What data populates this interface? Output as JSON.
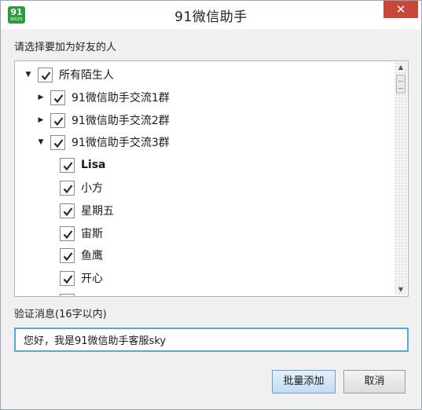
{
  "window": {
    "title": "91微信助手",
    "logo_top": "91",
    "logo_bottom": "WXZS",
    "close_glyph": "✕"
  },
  "prompt": "请选择要加为好友的人",
  "tree": {
    "root": {
      "label": "所有陌生人",
      "expanded": true,
      "checked": true
    },
    "groups": [
      {
        "label": "91微信助手交流1群",
        "expanded": false,
        "checked": true
      },
      {
        "label": "91微信助手交流2群",
        "expanded": false,
        "checked": true
      },
      {
        "label": "91微信助手交流3群",
        "expanded": true,
        "checked": true
      }
    ],
    "members": [
      {
        "label": "Lisa",
        "checked": true
      },
      {
        "label": "小方",
        "checked": true
      },
      {
        "label": "星期五",
        "checked": true
      },
      {
        "label": "宙斯",
        "checked": true
      },
      {
        "label": "鱼鹰",
        "checked": true
      },
      {
        "label": "开心",
        "checked": true
      }
    ]
  },
  "message": {
    "label": "验证消息(16字以内)",
    "value": "您好，我是91微信助手客服sky"
  },
  "buttons": {
    "batch_add": "批量添加",
    "cancel": "取消"
  },
  "colors": {
    "close_button": "#c9473a",
    "logo": "#2e9a3e",
    "input_focus_border": "#5aa7d6"
  }
}
